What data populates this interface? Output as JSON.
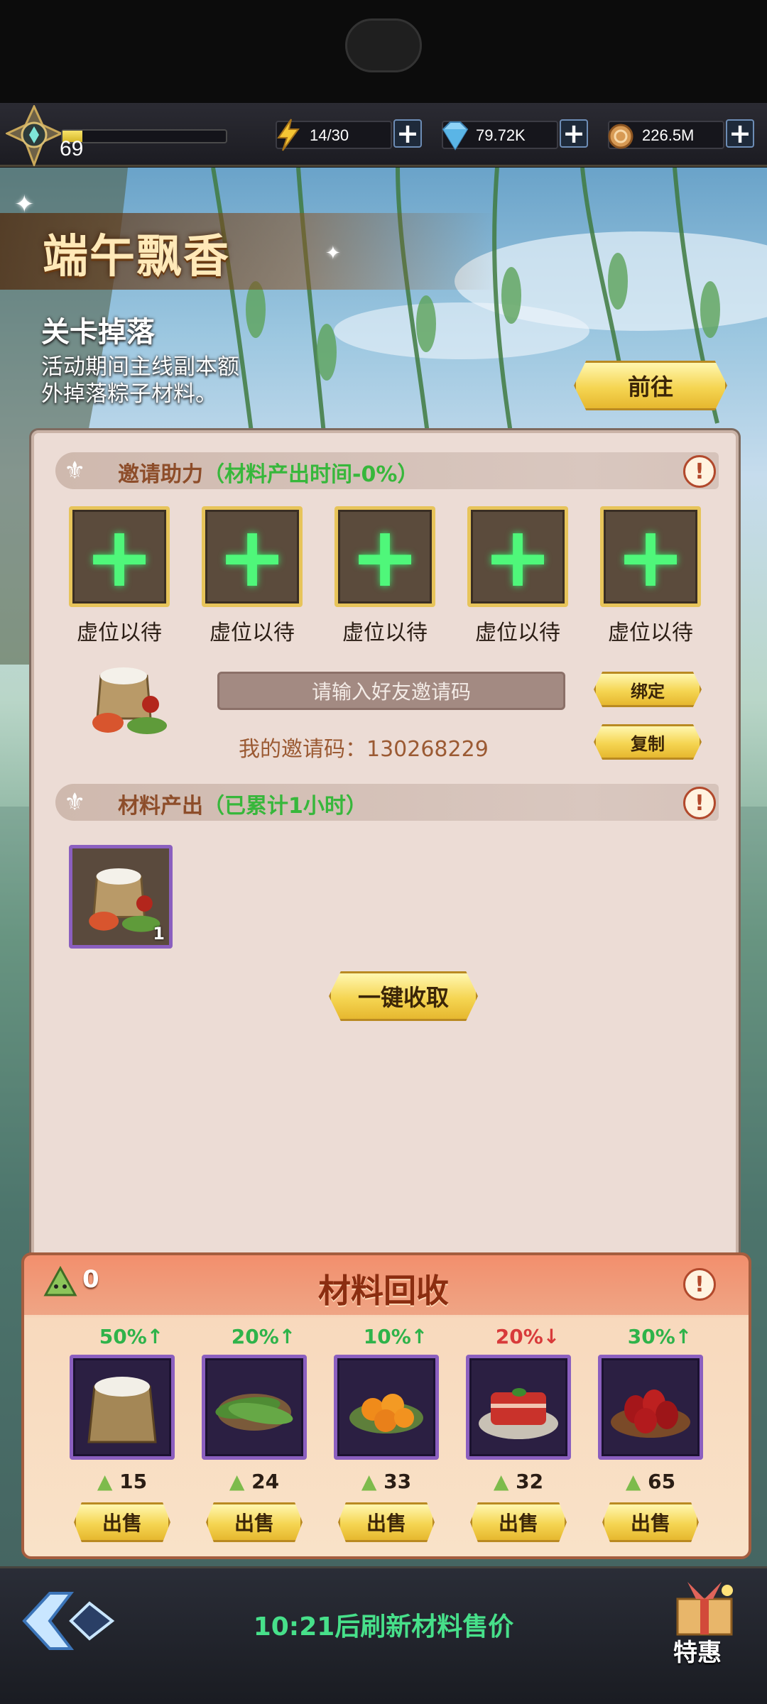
{
  "top_bar": {
    "level": "69",
    "xp_fraction": 0.12,
    "energy": "14/30",
    "gems": "79.72K",
    "coins": "226.5M"
  },
  "event": {
    "title": "端午飘香",
    "drop_title": "关卡掉落",
    "drop_desc_line1": "活动期间主线副本额",
    "drop_desc_line2": "外掉落粽子材料。",
    "goto_label": "前往"
  },
  "invite": {
    "header": "邀请助力",
    "header_sub": "（材料产出时间-0%）",
    "slots": [
      "虚位以待",
      "虚位以待",
      "虚位以待",
      "虚位以待",
      "虚位以待"
    ],
    "input_placeholder": "请输入好友邀请码",
    "my_code_label": "我的邀请码：130268229",
    "bind_label": "绑定",
    "copy_label": "复制"
  },
  "output": {
    "header": "材料产出",
    "header_sub": "（已累计1小时）",
    "item_count": "1",
    "collect_label": "一键收取"
  },
  "recycle": {
    "title": "材料回收",
    "zongzi_count": "0",
    "items": [
      {
        "pct": "50%↑",
        "trend": "up",
        "price": "15",
        "sell": "出售",
        "icon": "rice-bag-icon"
      },
      {
        "pct": "20%↑",
        "trend": "up",
        "price": "24",
        "sell": "出售",
        "icon": "leaves-icon"
      },
      {
        "pct": "10%↑",
        "trend": "up",
        "price": "33",
        "sell": "出售",
        "icon": "egg-yolk-icon"
      },
      {
        "pct": "20%↓",
        "trend": "down",
        "price": "32",
        "sell": "出售",
        "icon": "pork-icon"
      },
      {
        "pct": "30%↑",
        "trend": "up",
        "price": "65",
        "sell": "出售",
        "icon": "dates-icon"
      }
    ]
  },
  "footer": {
    "refresh_text": "10:21后刷新材料售价",
    "special_label": "特惠"
  },
  "colors": {
    "gold": "#f5d552",
    "green_plus": "#4ff77a",
    "up": "#2fb34a",
    "down": "#d83a3a"
  }
}
